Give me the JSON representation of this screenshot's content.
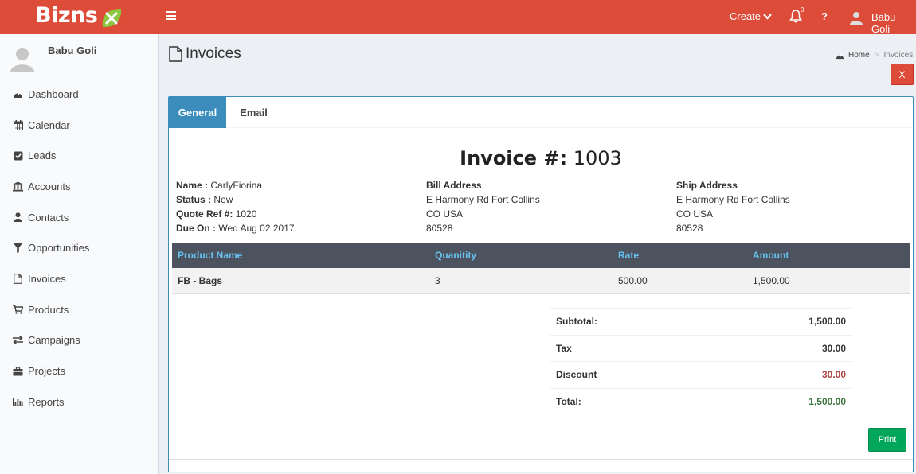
{
  "brand": {
    "name": "Bizns",
    "accent": "#dd4b39",
    "logo_icon": "green-leaf-x-icon"
  },
  "topbar": {
    "create_label": "Create",
    "notification_count": "0",
    "help_label": "?",
    "user_name": "Babu Goli"
  },
  "sidebar": {
    "user_name": "Babu Goli",
    "items": [
      {
        "label": "Dashboard",
        "icon": "dashboard-icon"
      },
      {
        "label": "Calendar",
        "icon": "calendar-icon"
      },
      {
        "label": "Leads",
        "icon": "check-square-icon"
      },
      {
        "label": "Accounts",
        "icon": "bank-icon"
      },
      {
        "label": "Contacts",
        "icon": "user-icon"
      },
      {
        "label": "Opportunities",
        "icon": "filter-icon"
      },
      {
        "label": "Invoices",
        "icon": "file-icon"
      },
      {
        "label": "Products",
        "icon": "cart-icon"
      },
      {
        "label": "Campaigns",
        "icon": "exchange-icon"
      },
      {
        "label": "Projects",
        "icon": "briefcase-icon"
      },
      {
        "label": "Reports",
        "icon": "bar-chart-icon"
      }
    ]
  },
  "page": {
    "title": "Invoices",
    "breadcrumb": {
      "home": "Home",
      "current": "Invoices"
    },
    "close_label": "X"
  },
  "tabs": [
    {
      "label": "General",
      "active": true
    },
    {
      "label": "Email",
      "active": false
    }
  ],
  "invoice": {
    "title_prefix": "Invoice #:",
    "number": "1003",
    "fields": {
      "name_label": "Name :",
      "name_value": "CarlyFiorina",
      "status_label": "Status :",
      "status_value": "New",
      "quote_label": "Quote Ref #:",
      "quote_value": "1020",
      "due_label": "Due On :",
      "due_value": "Wed Aug 02 2017"
    },
    "bill": {
      "heading": "Bill Address",
      "line1": "E Harmony Rd Fort Collins",
      "line2": "CO USA",
      "line3": "80528"
    },
    "ship": {
      "heading": "Ship Address",
      "line1": "E Harmony Rd Fort Collins",
      "line2": "CO USA",
      "line3": "80528"
    },
    "table": {
      "headers": [
        "Product Name",
        "Quanitity",
        "Rate",
        "Amount"
      ],
      "rows": [
        [
          "FB - Bags",
          "3",
          "500.00",
          "1,500.00"
        ]
      ]
    },
    "totals": {
      "subtotal_label": "Subtotal:",
      "subtotal_value": "1,500.00",
      "tax_label": "Tax",
      "tax_value": "30.00",
      "discount_label": "Discount",
      "discount_value": "30.00",
      "total_label": "Total:",
      "total_value": "1,500.00"
    },
    "print_label": "Print"
  }
}
